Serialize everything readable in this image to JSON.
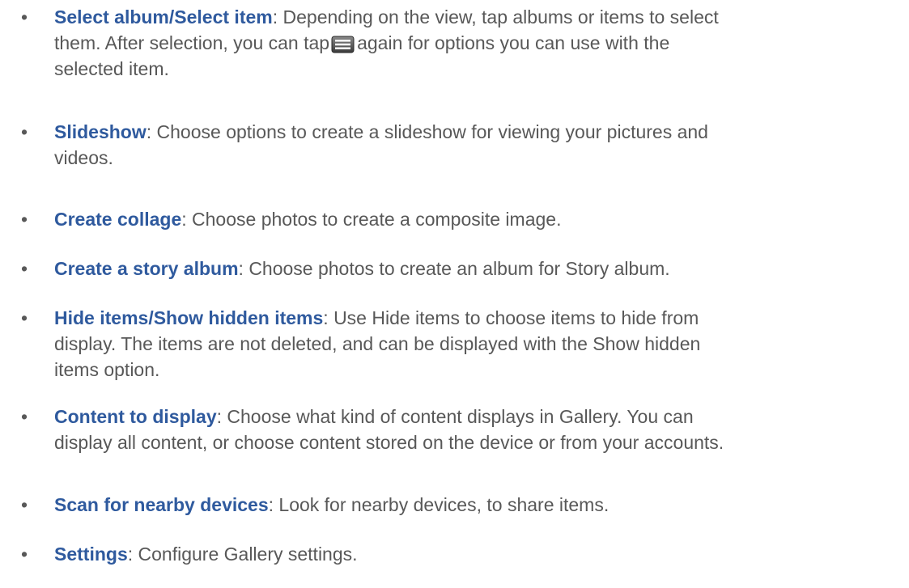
{
  "bullet_char": "•",
  "items": [
    {
      "term": "Select album/Select item",
      "lines": [
        "Depending on the view, tap albums or items to select",
        "them. After selection, you can tap",
        "again for options you can use with the",
        "selected item."
      ],
      "icon": "menu-key-icon"
    },
    {
      "term": "Slideshow",
      "lines": [
        "Choose options to create a slideshow for viewing your pictures and",
        "videos."
      ]
    },
    {
      "term": "Create collage",
      "lines": [
        "Choose photos to create a composite image."
      ]
    },
    {
      "term": "Create a story album",
      "lines": [
        "Choose photos to create an album for Story album."
      ]
    },
    {
      "term": "Hide items/Show hidden items",
      "lines": [
        "Use Hide items to choose items to hide from",
        "display. The items are not deleted, and can be displayed with the Show hidden",
        "items option."
      ]
    },
    {
      "term": "Content to display",
      "lines": [
        "Choose what kind of content displays in Gallery. You can",
        "display all content, or choose content stored on the device or from your accounts."
      ]
    },
    {
      "term": "Scan for nearby devices",
      "lines": [
        "Look for nearby devices, to share items."
      ]
    },
    {
      "term": "Settings",
      "lines": [
        "Configure Gallery settings."
      ]
    }
  ],
  "colors": {
    "term": "#2f5a9e",
    "text": "#585858"
  }
}
